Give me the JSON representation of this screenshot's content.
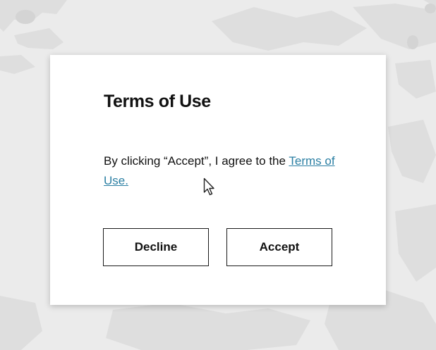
{
  "dialog": {
    "title": "Terms of Use",
    "message_prefix": "By clicking “Accept”, I agree to the ",
    "link_text": "Terms of Use.",
    "decline_label": "Decline",
    "accept_label": "Accept"
  },
  "colors": {
    "background": "#e9e9e9",
    "map_land": "#dcdcdc",
    "link": "#2b7fa3",
    "border": "#1a1a1a"
  },
  "icons": {
    "cursor": "mouse-pointer-icon"
  }
}
